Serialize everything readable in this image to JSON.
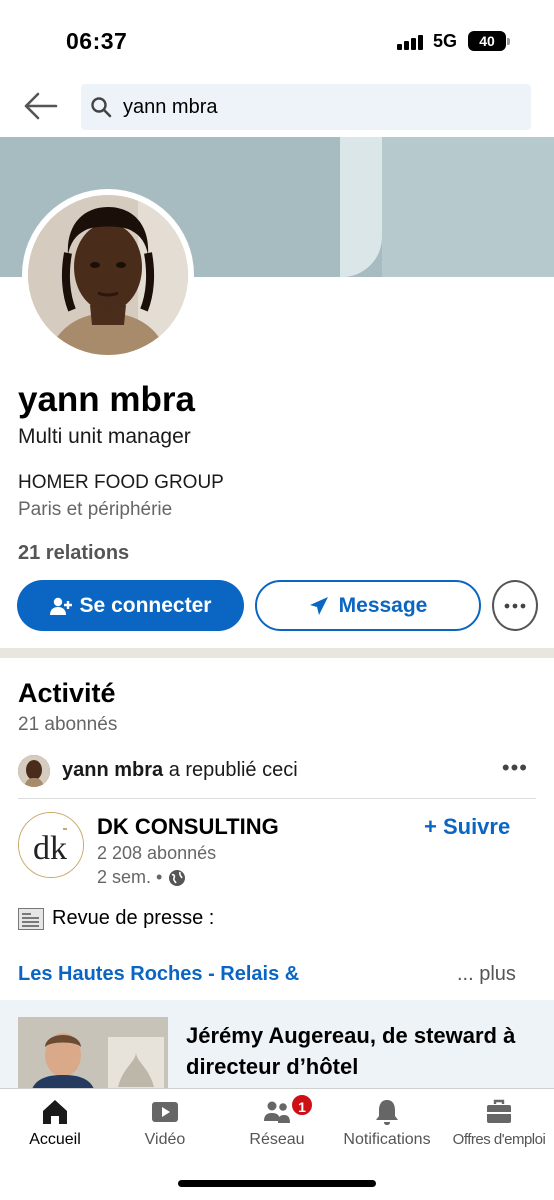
{
  "status_bar": {
    "time": "06:37",
    "network": "5G",
    "battery": "40"
  },
  "search": {
    "query": "yann mbra"
  },
  "profile": {
    "name": "yann mbra",
    "headline": "Multi unit manager",
    "company": "HOMER FOOD GROUP",
    "location": "Paris et périphérie",
    "relations": "21 relations"
  },
  "actions": {
    "connect_label": "Se connecter",
    "message_label": "Message"
  },
  "activity": {
    "title": "Activité",
    "followers": "21 abonnés",
    "repost": {
      "name": "yann mbra",
      "action": " a republié ceci"
    },
    "post": {
      "author": "DK CONSULTING",
      "author_followers": "2 208 abonnés",
      "time": "2 sem. •",
      "follow_label": "+ Suivre",
      "text": "Revue de presse :",
      "link_text": "Les Hautes Roches - Relais &",
      "more_label": "... plus",
      "card_title": "Jérémy Augereau, de steward à directeur d’hôtel"
    }
  },
  "tabbar": {
    "items": [
      {
        "label": "Accueil",
        "icon": "home-icon",
        "active": true
      },
      {
        "label": "Vidéo",
        "icon": "video-icon"
      },
      {
        "label": "Réseau",
        "icon": "network-icon",
        "badge": "1"
      },
      {
        "label": "Notifications",
        "icon": "bell-icon"
      },
      {
        "label": "Offres d'emploi",
        "icon": "briefcase-icon"
      }
    ]
  },
  "colors": {
    "brand_blue": "#0a66c2",
    "badge_red": "#cc1016",
    "banner": "#a7bcc0"
  }
}
